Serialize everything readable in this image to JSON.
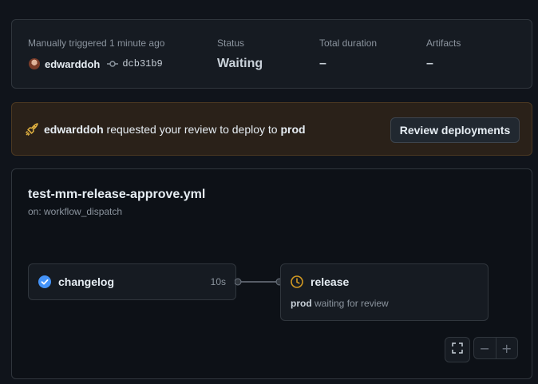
{
  "summary": {
    "trigger_label": "Manually triggered 1 minute ago",
    "actor": "edwarddoh",
    "commit_sha": "dcb31b9",
    "status_label": "Status",
    "status_value": "Waiting",
    "duration_label": "Total duration",
    "duration_value": "–",
    "artifacts_label": "Artifacts",
    "artifacts_value": "–"
  },
  "banner": {
    "actor": "edwarddoh",
    "message": " requested your review to deploy to ",
    "environment": "prod",
    "button_label": "Review deployments",
    "accent_color": "#e3b341"
  },
  "workflow": {
    "file_name": "test-mm-release-approve.yml",
    "trigger": "on: workflow_dispatch",
    "jobs": [
      {
        "name": "changelog",
        "duration": "10s",
        "status": "success",
        "icon": "check-circle-icon",
        "color": "#4493f8"
      },
      {
        "name": "release",
        "environment": "prod",
        "detail": " waiting for review",
        "status": "waiting",
        "icon": "clock-icon",
        "color": "#d29922"
      }
    ],
    "controls": {
      "fit_icon": "fullscreen-icon",
      "zoom_out": "−",
      "zoom_in": "+"
    }
  }
}
